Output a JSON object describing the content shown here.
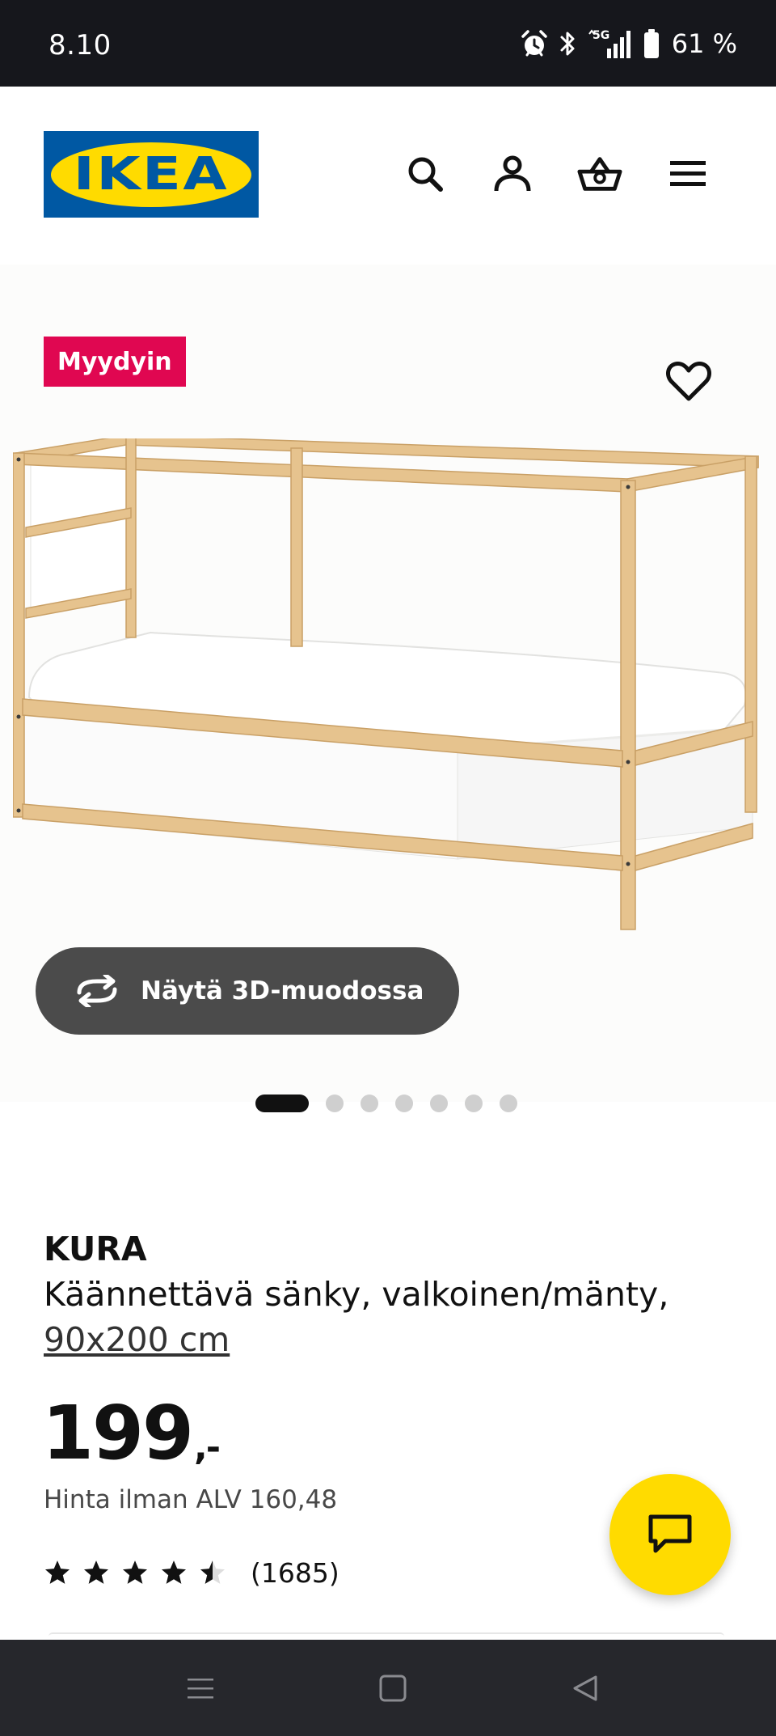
{
  "status_bar": {
    "time": "8.10",
    "battery": "61 %",
    "icons": [
      "alarm-icon",
      "bluetooth-icon",
      "5g-signal-icon",
      "battery-icon"
    ]
  },
  "header": {
    "logo_text": "IKEA",
    "icons": [
      "search-icon",
      "account-icon",
      "basket-icon",
      "menu-icon"
    ],
    "colors": {
      "logo_blue": "#0058a3",
      "logo_yellow": "#ffdb00"
    }
  },
  "gallery": {
    "badge": "Myydyin",
    "badge_color": "#e00751",
    "favorite_icon": "heart-icon",
    "view_3d_label": "Näytä 3D-muodossa",
    "view_3d_icon": "rotate-icon",
    "pagination": {
      "total": 7,
      "active_index": 0
    }
  },
  "product": {
    "brand": "KURA",
    "description": "Käännettävä sänky, valkoinen/mänty,",
    "size": "90x200 cm",
    "price": "199",
    "price_suffix": ",-",
    "vat_text": "Hinta ilman ALV 160,48",
    "rating": {
      "value": 4.5,
      "max": 5,
      "count": "(1685)"
    }
  },
  "chat": {
    "icon": "chat-icon",
    "color": "#ffdb00"
  },
  "nav_bar": {
    "buttons": [
      "recent-apps-button",
      "home-button",
      "back-button"
    ]
  }
}
